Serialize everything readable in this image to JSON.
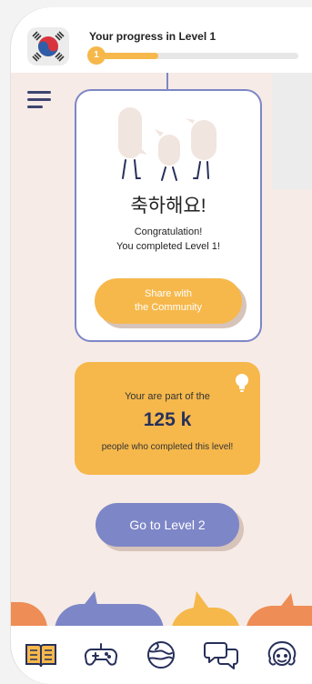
{
  "header": {
    "progress_title": "Your progress in Level 1",
    "level_badge": "1",
    "progress_fraction": 0.33,
    "flag_icon": "south-korea-flag"
  },
  "card": {
    "title_ko": "축하해요!",
    "line1": "Congratulation!",
    "line2": "You completed Level 1!",
    "share_line1": "Share with",
    "share_line2": "the Community"
  },
  "stats": {
    "line1": "Your are part of the",
    "count": "125 k",
    "line2": "people who completed this level!",
    "icon": "lightbulb-icon"
  },
  "next_button": "Go to Level 2",
  "nav": [
    "book-icon",
    "gamepad-icon",
    "globe-icon",
    "chat-icon",
    "avatar-icon"
  ],
  "colors": {
    "background": "#f6ebe6",
    "primary": "#7d86c7",
    "accent": "#f6b84b",
    "dark": "#27305a",
    "orange": "#ee8d55"
  }
}
